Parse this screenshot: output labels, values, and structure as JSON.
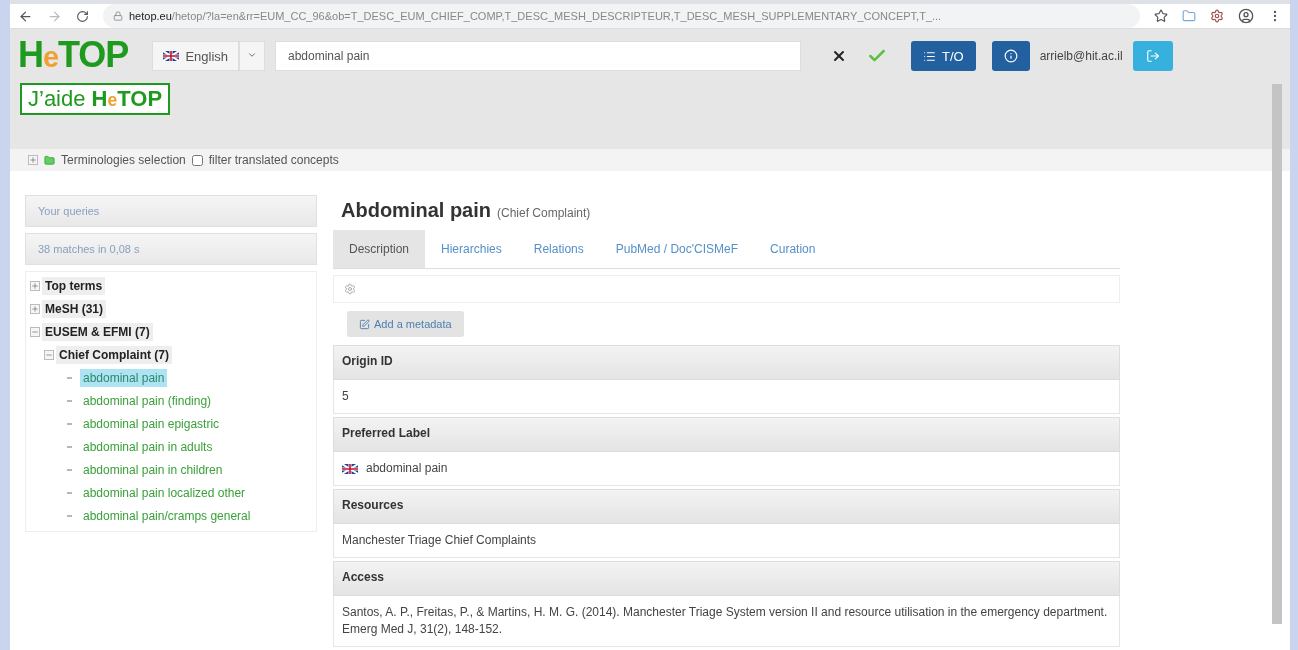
{
  "browser": {
    "url_host": "hetop.eu",
    "url_path": "/hetop/?la=en&rr=EUM_CC_96&ob=T_DESC_EUM_CHIEF_COMP,T_DESC_MESH_DESCRIPTEUR,T_DESC_MESH_SUPPLEMENTARY_CONCEPT,T_..."
  },
  "header": {
    "logo": {
      "before": "H",
      "accent": "e",
      "after": "TOP"
    },
    "language": "English",
    "search_value": "abdominal pain",
    "to_button": "T/O",
    "user": "arrielb@hit.ac.il",
    "help": {
      "prefix": "J’aide",
      "before": "H",
      "accent": "e",
      "after": "TOP"
    }
  },
  "filter": {
    "terminologies": "Terminologies selection",
    "translated": {
      "label": "filter translated concepts",
      "checked": false
    }
  },
  "sidebar": {
    "queries": "Your queries",
    "matches": "38 matches in 0,08 s",
    "tree": [
      {
        "kind": "group",
        "label": "Top terms",
        "expanded": false
      },
      {
        "kind": "group",
        "label": "MeSH (31)",
        "expanded": false
      },
      {
        "kind": "group",
        "label": "EUSEM & EFMI (7)",
        "expanded": true,
        "children": [
          {
            "kind": "group",
            "label": "Chief Complaint (7)",
            "expanded": true,
            "children": [
              {
                "kind": "leaf",
                "label": "abdominal pain",
                "selected": true
              },
              {
                "kind": "leaf",
                "label": "abdominal pain (finding)",
                "selected": false
              },
              {
                "kind": "leaf",
                "label": "abdominal pain epigastric",
                "selected": false
              },
              {
                "kind": "leaf",
                "label": "abdominal pain in adults",
                "selected": false
              },
              {
                "kind": "leaf",
                "label": "abdominal pain in children",
                "selected": false
              },
              {
                "kind": "leaf",
                "label": "abdominal pain localized other",
                "selected": false
              },
              {
                "kind": "leaf",
                "label": "abdominal pain/cramps general",
                "selected": false
              }
            ]
          }
        ]
      }
    ]
  },
  "concept": {
    "title": "Abdominal pain",
    "subtitle": "(Chief Complaint)",
    "tabs": [
      {
        "label": "Description",
        "selected": true
      },
      {
        "label": "Hierarchies",
        "selected": false
      },
      {
        "label": "Relations",
        "selected": false
      },
      {
        "label": "PubMed / Doc'CISMeF",
        "selected": false
      },
      {
        "label": "Curation",
        "selected": false
      }
    ],
    "add_metadata": "Add a metadata",
    "sections": [
      {
        "heading": "Origin ID",
        "value": "5",
        "flag": false
      },
      {
        "heading": "Preferred Label",
        "value": "abdominal pain",
        "flag": true
      },
      {
        "heading": "Resources",
        "value": "Manchester Triage Chief Complaints",
        "flag": false
      },
      {
        "heading": "Access",
        "value": "Santos, A. P., Freitas, P., & Martins, H. M. G. (2014). Manchester Triage System version II and resource utilisation in the emergency department. Emerg Med J, 31(2), 148-152.",
        "flag": false
      }
    ]
  }
}
